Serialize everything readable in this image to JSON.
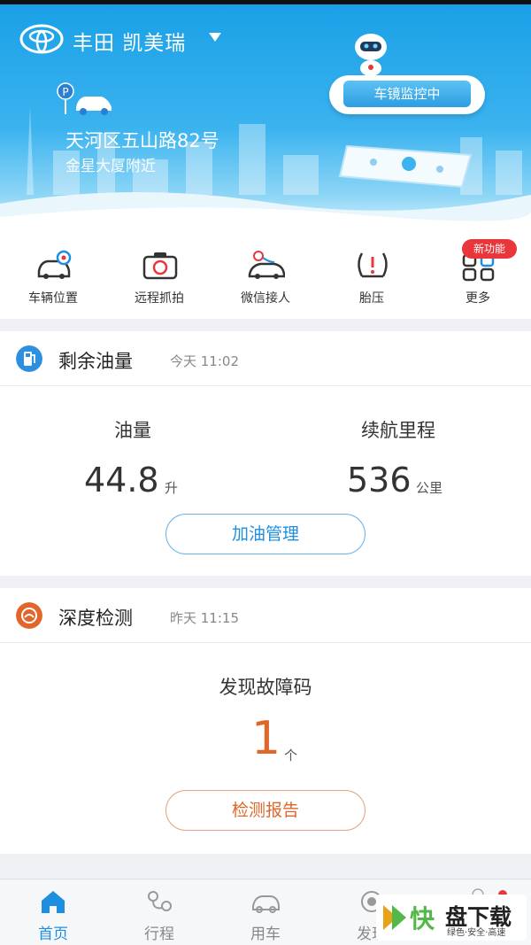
{
  "header": {
    "car_name": "丰田 凯美瑞",
    "address_line1": "天河区五山路82号",
    "address_line2": "金星大厦附近",
    "mirror_label": "车镜监控中"
  },
  "quick_actions": [
    {
      "label": "车辆位置",
      "icon": "car-location-icon"
    },
    {
      "label": "远程抓拍",
      "icon": "camera-icon"
    },
    {
      "label": "微信接人",
      "icon": "wechat-car-icon"
    },
    {
      "label": "胎压",
      "icon": "tire-pressure-icon"
    },
    {
      "label": "更多",
      "icon": "more-grid-icon",
      "badge": "新功能"
    }
  ],
  "fuel_card": {
    "title": "剩余油量",
    "time": "今天 11:02",
    "fuel_label": "油量",
    "fuel_value": "44.8",
    "fuel_unit": "升",
    "range_label": "续航里程",
    "range_value": "536",
    "range_unit": "公里",
    "button": "加油管理"
  },
  "check_card": {
    "title": "深度检测",
    "time": "昨天 11:15",
    "fault_label": "发现故障码",
    "fault_value": "1",
    "fault_unit": "个",
    "button": "检测报告"
  },
  "bottom_nav": [
    {
      "label": "首页",
      "icon": "home-icon",
      "active": true
    },
    {
      "label": "行程",
      "icon": "route-icon",
      "active": false
    },
    {
      "label": "用车",
      "icon": "car-icon",
      "active": false
    },
    {
      "label": "发现",
      "icon": "discover-icon",
      "active": false
    }
  ],
  "watermark": {
    "brand": "快",
    "name": "盘下载",
    "slogan": "绿色·安全·高速"
  },
  "colors": {
    "accent": "#1e8fe0",
    "orange": "#e0662a",
    "badge": "#e8363a",
    "header": "#1aa0e6"
  }
}
